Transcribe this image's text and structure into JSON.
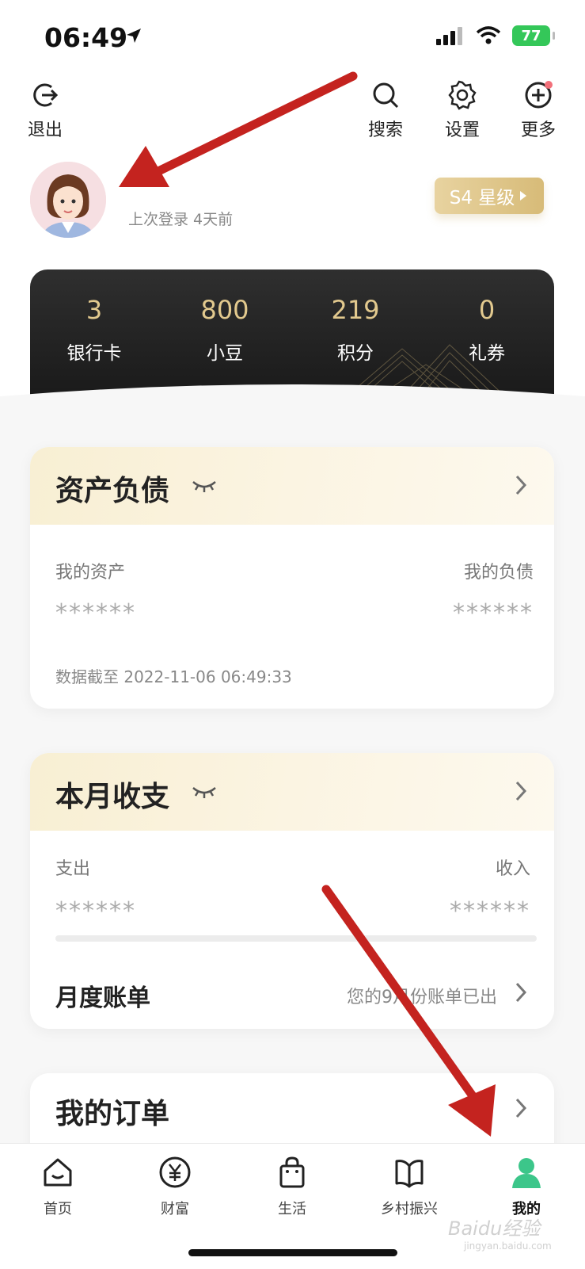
{
  "status_bar": {
    "time": "06:49",
    "battery": "77"
  },
  "top_nav": {
    "exit": "退出",
    "search": "搜索",
    "settings": "设置",
    "more": "更多"
  },
  "profile": {
    "last_login": "上次登录 4天前",
    "level": "S4 星级"
  },
  "stats": [
    {
      "value": "3",
      "label": "银行卡"
    },
    {
      "value": "800",
      "label": "小豆"
    },
    {
      "value": "219",
      "label": "积分"
    },
    {
      "value": "0",
      "label": "礼券"
    }
  ],
  "assets_card": {
    "title": "资产负债",
    "assets_label": "我的资产",
    "liabilities_label": "我的负债",
    "assets_value": "******",
    "liabilities_value": "******",
    "timestamp": "数据截至 2022-11-06 06:49:33"
  },
  "monthly_card": {
    "title": "本月收支",
    "expense_label": "支出",
    "income_label": "收入",
    "expense_value": "******",
    "income_value": "******",
    "bill_title": "月度账单",
    "bill_note": "您的9月份账单已出"
  },
  "orders_card": {
    "title": "我的订单"
  },
  "tabbar": [
    {
      "label": "首页",
      "icon": "home-icon"
    },
    {
      "label": "财富",
      "icon": "yen-icon"
    },
    {
      "label": "生活",
      "icon": "shopping-bag-icon"
    },
    {
      "label": "乡村振兴",
      "icon": "book-icon"
    },
    {
      "label": "我的",
      "icon": "person-icon"
    }
  ],
  "watermark": {
    "text": "Baidu经验",
    "sub": "jingyan.baidu.com"
  },
  "colors": {
    "accent_green": "#3cc68a",
    "gold": "#e2c98e",
    "annotation_red": "#c4231f"
  }
}
